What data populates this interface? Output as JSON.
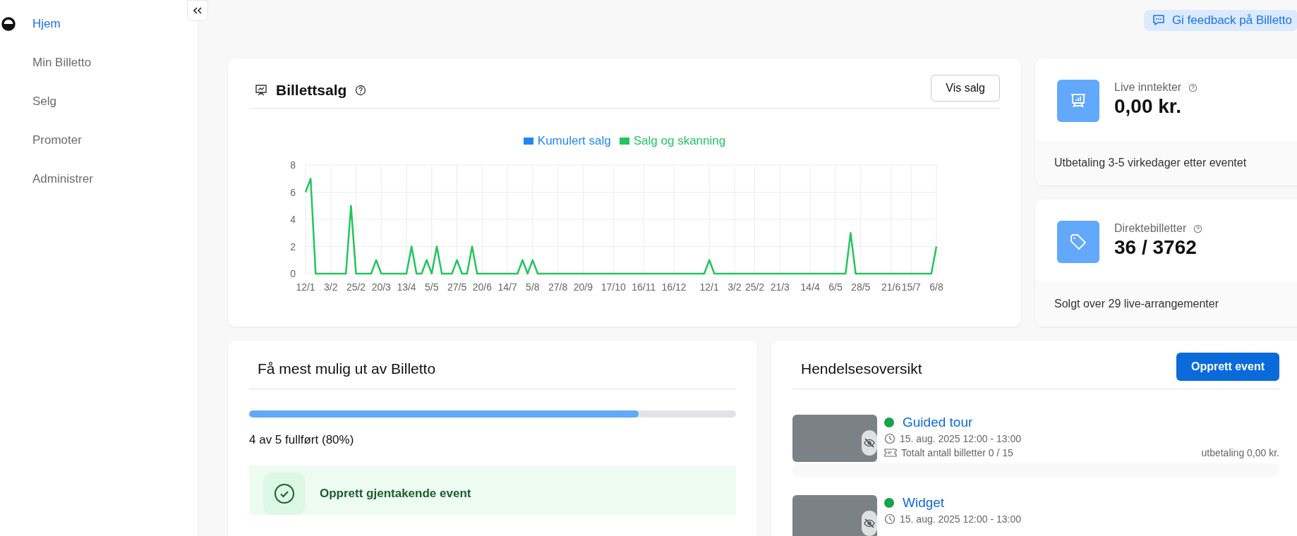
{
  "sidebar": {
    "items": [
      {
        "label": "Hjem",
        "selected": true
      },
      {
        "label": "Min Billetto",
        "selected": false
      },
      {
        "label": "Selg",
        "selected": false
      },
      {
        "label": "Promoter",
        "selected": false
      },
      {
        "label": "Administrer",
        "selected": false
      }
    ]
  },
  "feedback_button": {
    "label": "Gi feedback på Billetto"
  },
  "sales_card": {
    "title": "Billettsalg",
    "button": "Vis salg",
    "chart_data": {
      "type": "line",
      "grid": true,
      "ylim": [
        0,
        8
      ],
      "yticks": [
        0,
        2,
        4,
        6,
        8
      ],
      "categories": [
        "12/1",
        null,
        null,
        null,
        null,
        "3/2",
        null,
        null,
        null,
        null,
        "25/2",
        null,
        null,
        null,
        null,
        "20/3",
        null,
        null,
        null,
        null,
        "13/4",
        null,
        null,
        null,
        null,
        "5/5",
        null,
        null,
        null,
        null,
        "27/5",
        null,
        null,
        null,
        null,
        "20/6",
        null,
        null,
        null,
        null,
        "14/7",
        null,
        null,
        null,
        null,
        "5/8",
        null,
        null,
        null,
        null,
        "27/8",
        null,
        null,
        null,
        null,
        "20/9",
        null,
        null,
        null,
        null,
        null,
        "17/10",
        null,
        null,
        null,
        null,
        null,
        "16/11",
        null,
        null,
        null,
        null,
        null,
        "16/12",
        null,
        null,
        null,
        null,
        null,
        null,
        "12/1",
        null,
        null,
        null,
        null,
        "3/2",
        null,
        null,
        null,
        "25/2",
        null,
        null,
        null,
        null,
        "21/3",
        null,
        null,
        null,
        null,
        null,
        "14/4",
        null,
        null,
        null,
        null,
        "6/5",
        null,
        null,
        null,
        null,
        "28/5",
        null,
        null,
        null,
        null,
        null,
        "21/6",
        null,
        null,
        null,
        "15/7",
        null,
        null,
        null,
        null,
        "6/8"
      ],
      "series": [
        {
          "name": "Kumulert salg",
          "color": "#1e88f5",
          "values": [
            null,
            null,
            null,
            null,
            null,
            null,
            null,
            null,
            null,
            null,
            null,
            null,
            null,
            null,
            null,
            null,
            null,
            null,
            null,
            null,
            null,
            null,
            null,
            null,
            null,
            null,
            null,
            null,
            null,
            null,
            null,
            null,
            null,
            null,
            null,
            null,
            null,
            null,
            null,
            null,
            null,
            null,
            null,
            null,
            null,
            null,
            null,
            null,
            null,
            null,
            null,
            null,
            null,
            null,
            null,
            null,
            null,
            null,
            null,
            null,
            null,
            null,
            null,
            null,
            null,
            null,
            null,
            null,
            null,
            null,
            null,
            null,
            null,
            null,
            null,
            null,
            null,
            null,
            null,
            null,
            null,
            null,
            null,
            null,
            null,
            null,
            null,
            null,
            null,
            null,
            null,
            null,
            null,
            null,
            null,
            null,
            null,
            null,
            null,
            null,
            null,
            null,
            null,
            null,
            null,
            null,
            null,
            null,
            null,
            null,
            null,
            null,
            null,
            null,
            null,
            null,
            null,
            null,
            null,
            null,
            null,
            null,
            null,
            null,
            null,
            null
          ]
        },
        {
          "name": "Salg og skanning",
          "color": "#22c55e",
          "values": [
            6,
            7,
            0,
            0,
            0,
            0,
            0,
            0,
            0,
            5,
            0,
            0,
            0,
            0,
            1,
            0,
            0,
            0,
            0,
            0,
            0,
            2,
            0,
            0,
            1,
            0,
            2,
            0,
            0,
            0,
            1,
            0,
            0,
            2,
            0,
            0,
            0,
            0,
            0,
            0,
            0,
            0,
            0,
            1,
            0,
            1,
            0,
            0,
            0,
            0,
            0,
            0,
            0,
            0,
            0,
            0,
            0,
            0,
            0,
            0,
            0,
            0,
            0,
            0,
            0,
            0,
            0,
            0,
            0,
            0,
            0,
            0,
            0,
            0,
            0,
            0,
            0,
            0,
            0,
            0,
            1,
            0,
            0,
            0,
            0,
            0,
            0,
            0,
            0,
            0,
            0,
            0,
            0,
            0,
            0,
            0,
            0,
            0,
            0,
            0,
            0,
            0,
            0,
            0,
            0,
            0,
            0,
            0,
            3,
            0,
            0,
            0,
            0,
            0,
            0,
            0,
            0,
            0,
            0,
            0,
            0,
            0,
            0,
            0,
            0,
            2
          ]
        }
      ]
    }
  },
  "stat_cards": [
    {
      "kind": "revenue",
      "label": "Live inntekter",
      "value": "0,00 kr.",
      "footer": "Utbetaling 3-5 virkedager etter eventet"
    },
    {
      "kind": "tickets",
      "label": "Direktebilletter",
      "value": "36 / 3762",
      "footer": "Solgt over 29 live-arrangementer"
    }
  ],
  "onboarding": {
    "title": "Få mest mulig ut av Billetto",
    "level": 0.8,
    "progress_text": "4 av 5 fullført (80%)",
    "tasks": [
      {
        "label": "Opprett gjentakende event",
        "done": true
      }
    ]
  },
  "events": {
    "title": "Hendelsesoversikt",
    "button": "Opprett event",
    "items": [
      {
        "name": "Guided tour",
        "color": "#16a34a",
        "date": "15. aug. 2025 12:00 - 13:00",
        "tickets": "Totalt antall billetter 0 / 15",
        "payout": "utbetaling 0,00 kr."
      },
      {
        "name": "Widget",
        "color": "#16a34a",
        "date": "15. aug. 2025 12:00 - 13:00"
      }
    ]
  }
}
